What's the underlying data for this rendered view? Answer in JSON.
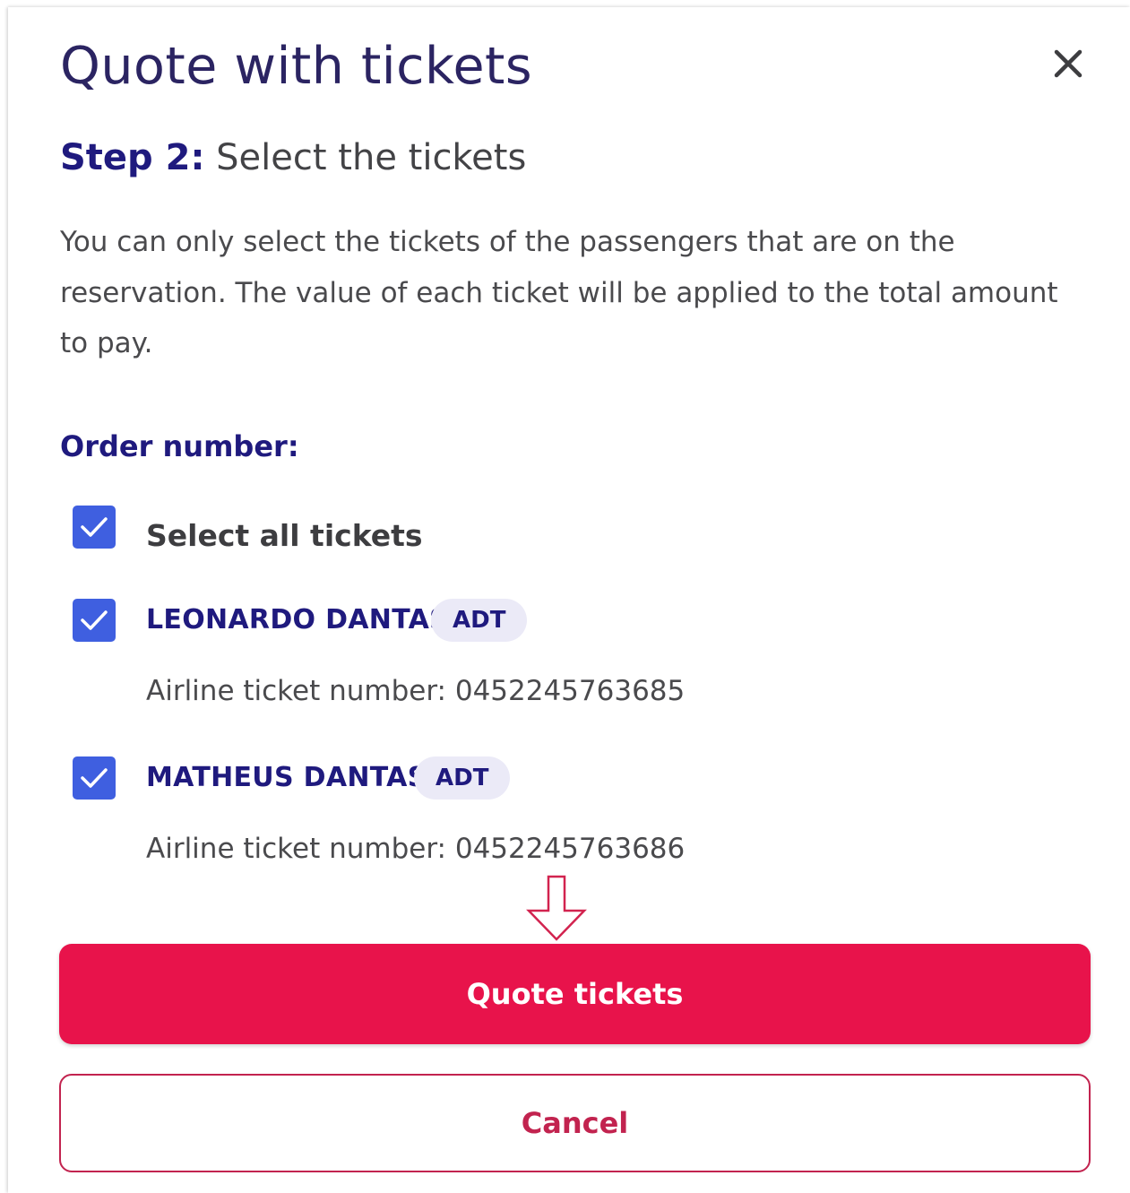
{
  "modal": {
    "title": "Quote with tickets",
    "close_icon": "close-icon"
  },
  "step": {
    "label": "Step 2:",
    "text": " Select the tickets"
  },
  "description": "You can only select the tickets of the passengers that are on the reservation. The value of each ticket will be applied to the total amount to pay.",
  "order": {
    "label": "Order number:"
  },
  "select_all": {
    "label": "Select all tickets",
    "checked": true
  },
  "passengers": [
    {
      "name": "LEONARDO DANTAS",
      "type": "ADT",
      "ticket_label": "Airline ticket number: 0452245763685",
      "checked": true
    },
    {
      "name": "MATHEUS DANTAS",
      "type": "ADT",
      "ticket_label": "Airline ticket number: 0452245763686",
      "checked": true
    }
  ],
  "actions": {
    "primary": "Quote tickets",
    "secondary": "Cancel"
  },
  "colors": {
    "title": "#2b2462",
    "accent_navy": "#1f1a7e",
    "checkbox": "#3f5fe0",
    "primary_button": "#e8134b",
    "cancel_border": "#c2234f",
    "badge_bg": "#ebeaf7"
  }
}
